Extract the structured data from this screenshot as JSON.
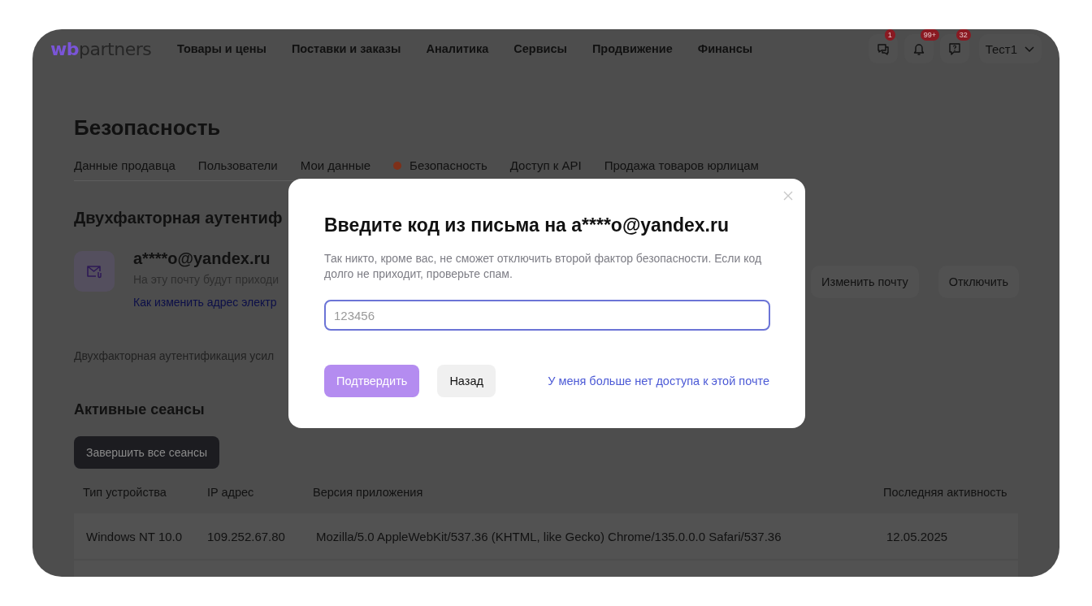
{
  "header": {
    "logo": {
      "part1": "wb",
      "part2": "partners"
    },
    "nav": [
      {
        "label": "Товары и цены"
      },
      {
        "label": "Поставки и заказы"
      },
      {
        "label": "Аналитика"
      },
      {
        "label": "Сервисы"
      },
      {
        "label": "Продвижение"
      },
      {
        "label": "Финансы"
      }
    ],
    "icons": [
      {
        "kind": "chat",
        "badge": "1"
      },
      {
        "kind": "bell",
        "badge": "99+"
      },
      {
        "kind": "help",
        "badge": "32"
      }
    ],
    "user": "Тест1"
  },
  "page": {
    "title": "Безопасность",
    "tabs": [
      {
        "label": "Данные продавца",
        "selected": false
      },
      {
        "label": "Пользователи",
        "selected": false
      },
      {
        "label": "Мои данные",
        "selected": false
      },
      {
        "label": "Безопасность",
        "selected": true
      },
      {
        "label": "Доступ к API",
        "selected": false
      },
      {
        "label": "Продажа товаров юрлицам",
        "selected": false
      }
    ],
    "two_factor": {
      "heading": "Двухфакторная аутентиф",
      "email": "a****o@yandex.ru",
      "hint": "На эту почту будут приходи",
      "link": "Как изменить адрес электр",
      "buttons": [
        "Изменить почту",
        "Отключить"
      ],
      "note": "Двухфакторная аутентификация усил"
    },
    "sessions": {
      "heading": "Активные сеансы",
      "button": "Завершить все сеансы",
      "columns": [
        "Тип устройства",
        "IP адрес",
        "Версия приложения",
        "Последняя активность"
      ],
      "rows": [
        [
          "Windows NT 10.0",
          "109.252.67.80",
          "Mozilla/5.0 AppleWebKit/537.36 (KHTML, like Gecko) Chrome/135.0.0.0 Safari/537.36",
          "12.05.2025"
        ]
      ]
    }
  },
  "modal": {
    "title": "Введите код из письма на a****o@yandex.ru",
    "description": "Так никто, кроме вас, не сможет отключить второй фактор безопасности. Если код долго не приходит, проверьте спам.",
    "input": {
      "placeholder": "123456"
    },
    "confirm": {
      "label": "Подтвердить",
      "disabled": true
    },
    "back": "Назад",
    "link": "У меня больше нет доступа к этой почте"
  }
}
